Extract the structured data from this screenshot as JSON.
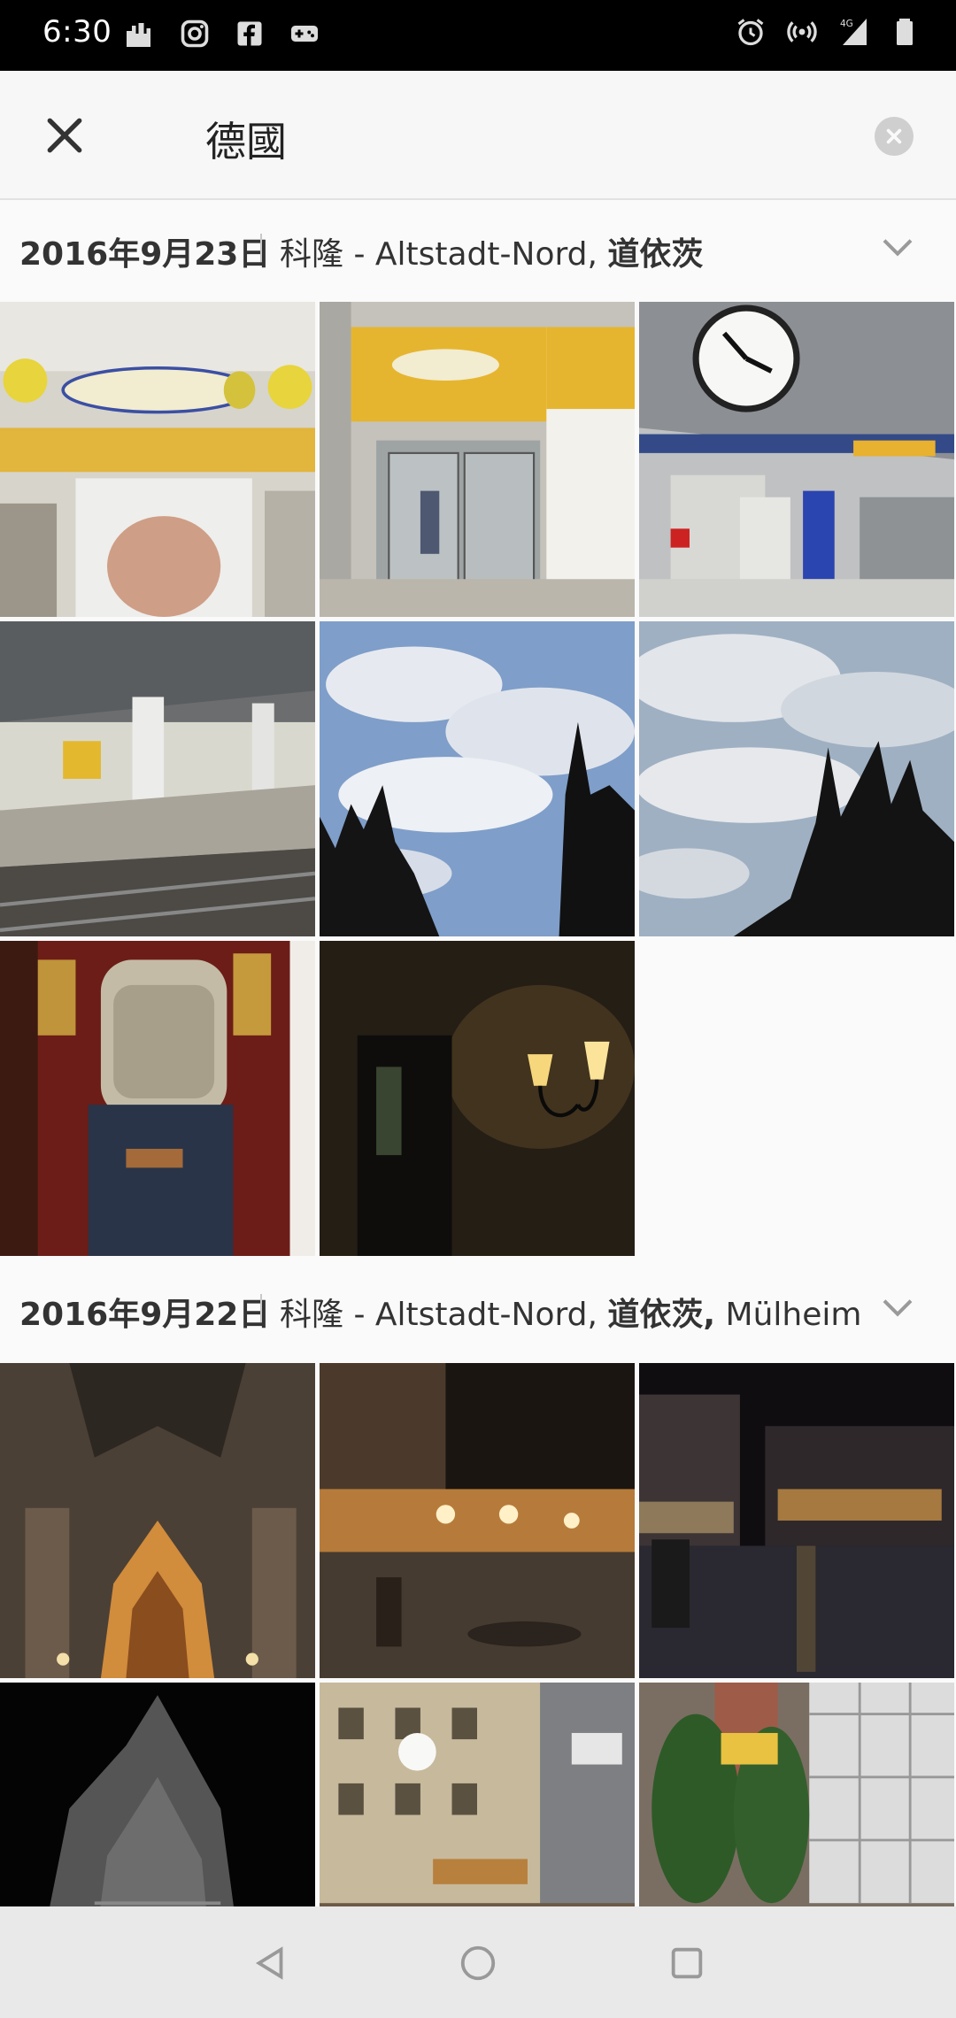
{
  "status": {
    "time": "6:30",
    "left_icons": [
      "cityscape-icon",
      "instagram-icon",
      "facebook-icon",
      "game-controller-icon"
    ],
    "right_icons": [
      "alarm-icon",
      "hotspot-icon",
      "signal-4g-icon",
      "battery-icon"
    ],
    "network": "4G"
  },
  "search": {
    "query": "德國",
    "close_icon": "close-icon",
    "clear_icon": "clear-circle-icon"
  },
  "sections": [
    {
      "date": "2016年9月23日",
      "place_main": "科隆 - Altstadt-Nord, ",
      "place_bold": "道依茨",
      "place_tail": "",
      "photos": [
        "rail-fresh-wc-sign",
        "rail-fresh-doors",
        "station-clock",
        "train-platform",
        "sky-cathedral-1",
        "sky-cathedral-2",
        "backpack-person",
        "wall-lamp"
      ]
    },
    {
      "date": "2016年9月22日",
      "place_main": "科隆 - Altstadt-Nord, ",
      "place_bold": "道依茨,",
      "place_tail": " Mülheim",
      "photos": [
        "cathedral-night-portal",
        "square-night-lamps",
        "street-night-reflection",
        "cathedral-spire-night",
        "fruh-brewery-street",
        "gilden-brauhaus"
      ]
    }
  ],
  "nav": {
    "back": "back-triangle-icon",
    "home": "home-circle-icon",
    "recents": "recents-square-icon"
  }
}
